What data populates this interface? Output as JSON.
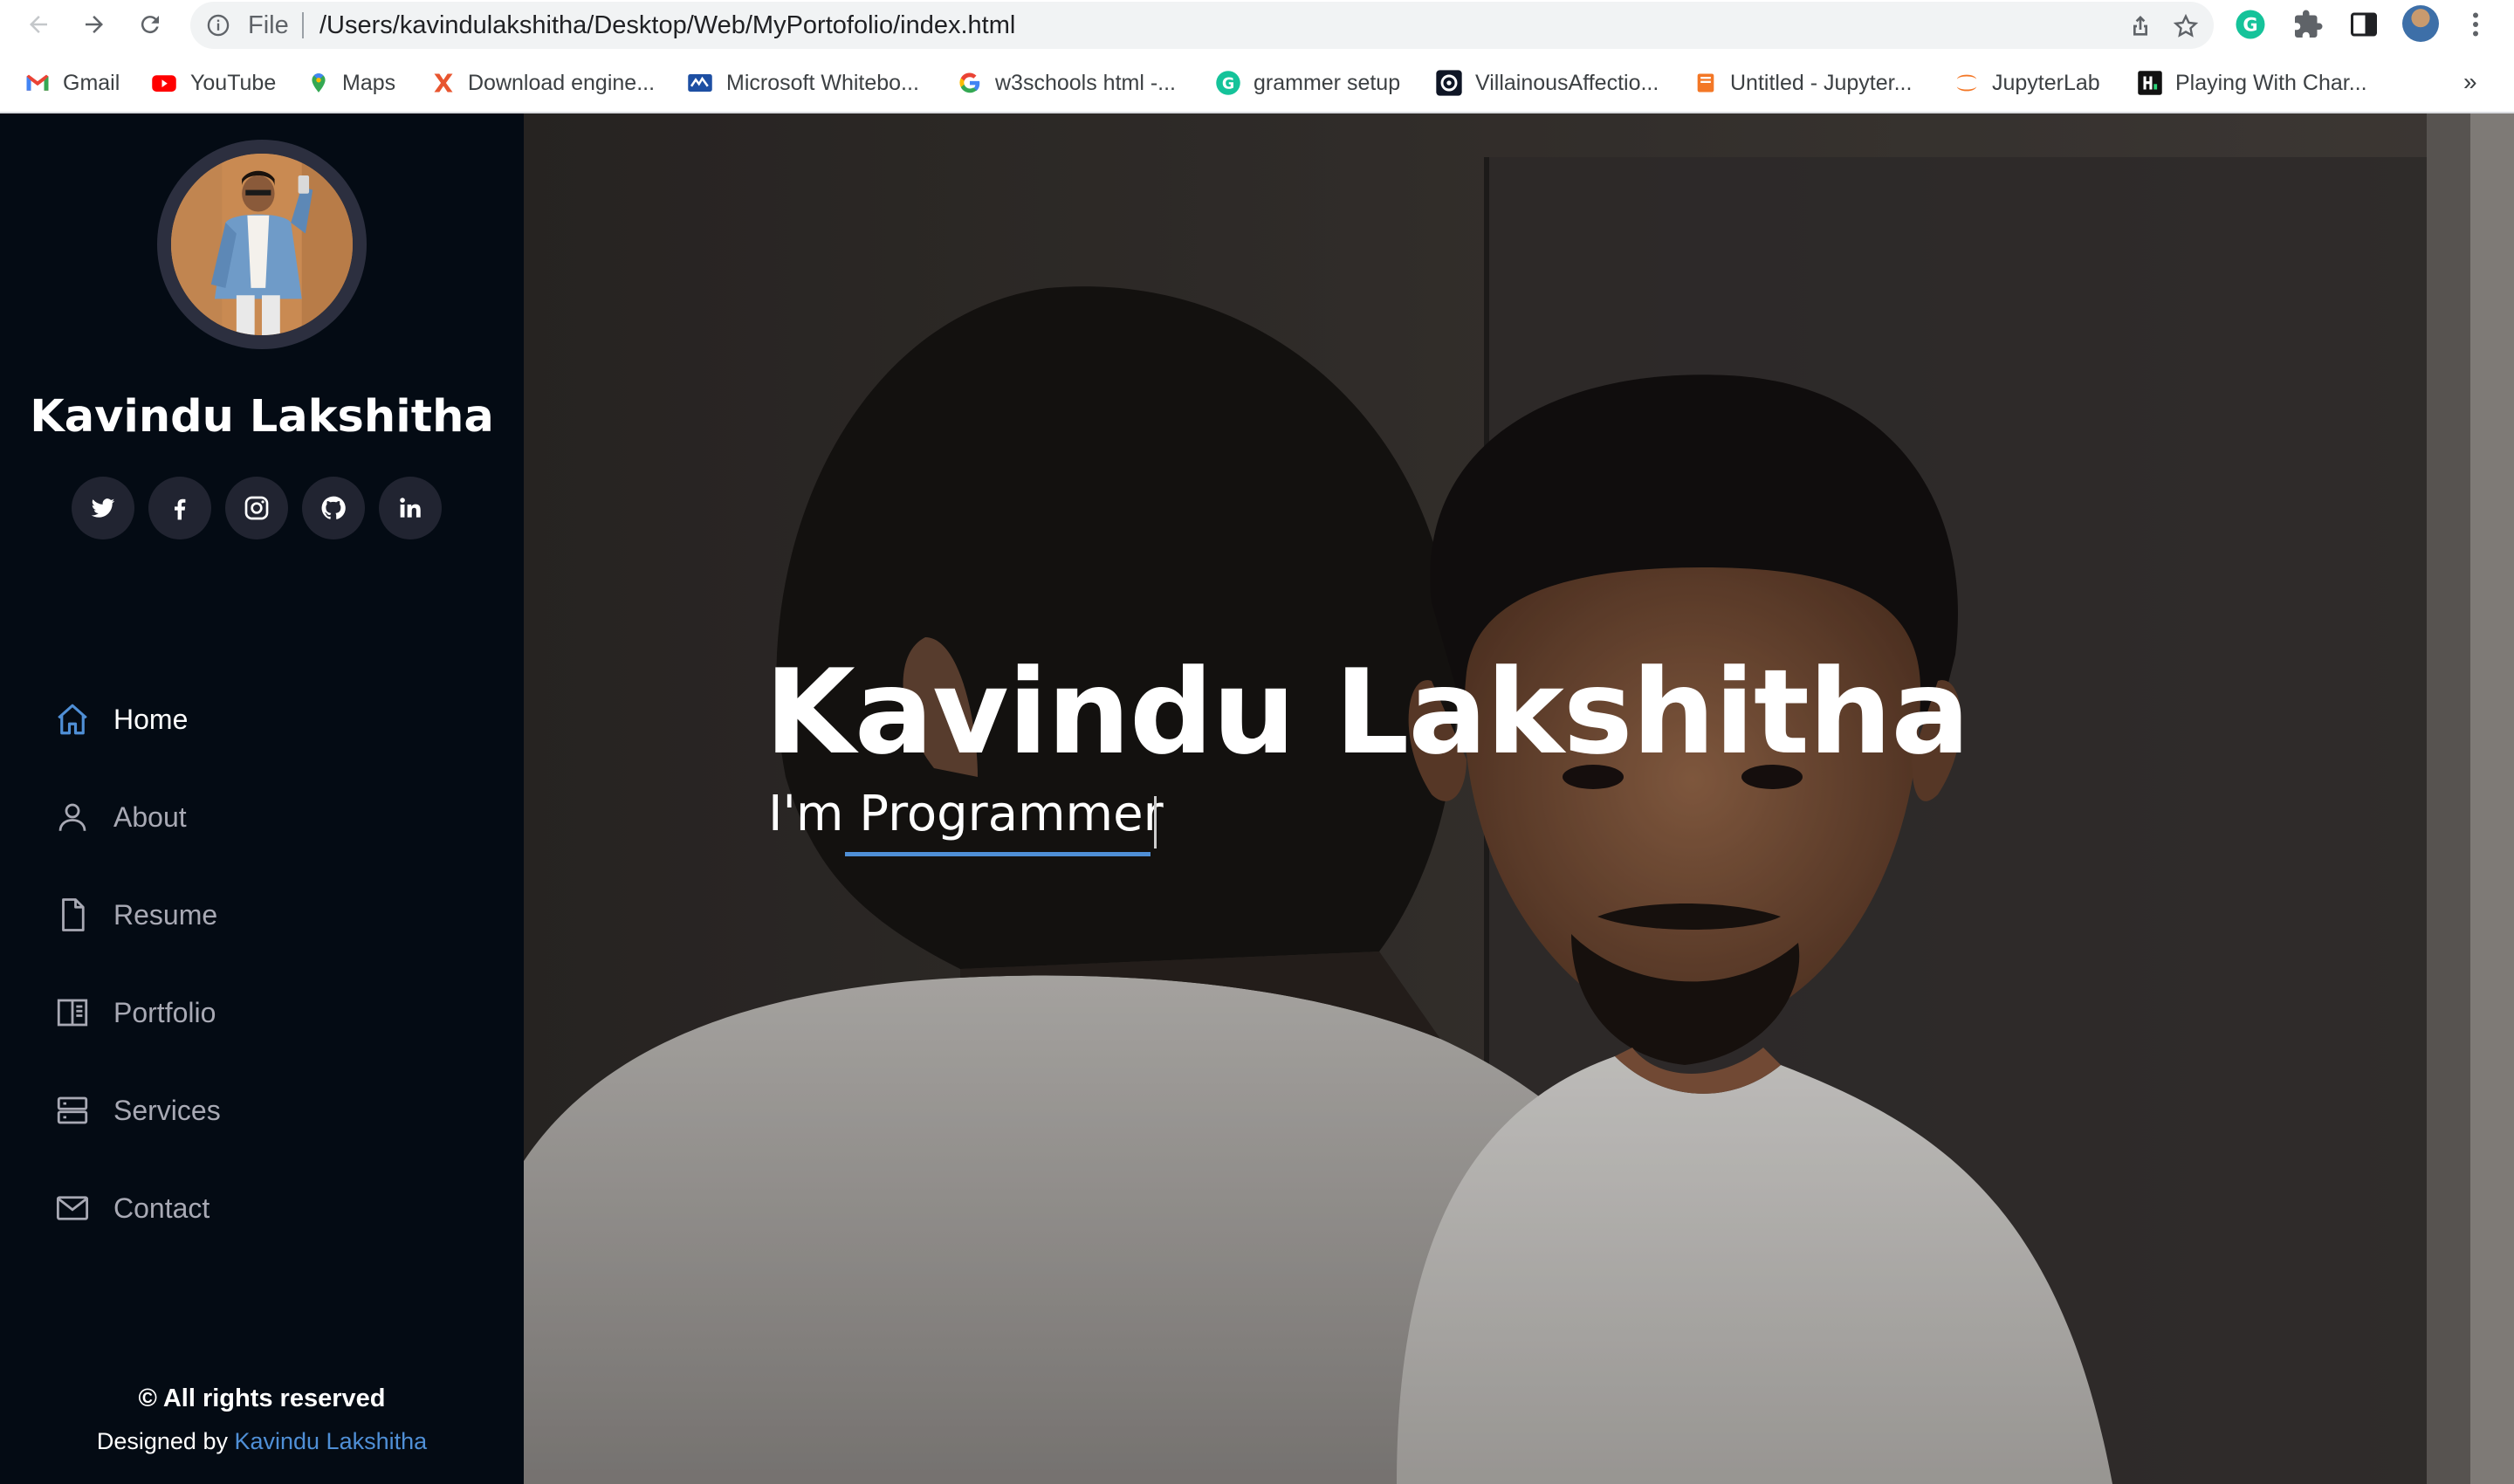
{
  "browser": {
    "scheme": "File",
    "url": "/Users/kavindulakshitha/Desktop/Web/MyPortofolio/index.html",
    "bookmarks": [
      {
        "label": "Gmail",
        "icon": "gmail-icon"
      },
      {
        "label": "YouTube",
        "icon": "youtube-icon"
      },
      {
        "label": "Maps",
        "icon": "maps-icon"
      },
      {
        "label": "Download engine...",
        "icon": "x-icon"
      },
      {
        "label": "Microsoft Whitebo...",
        "icon": "whiteboard-icon"
      },
      {
        "label": "w3schools html -...",
        "icon": "google-icon"
      },
      {
        "label": "grammer setup",
        "icon": "grammarly-icon"
      },
      {
        "label": "VillainousAffectio...",
        "icon": "replit-icon"
      },
      {
        "label": "Untitled - Jupyter...",
        "icon": "notebook-icon"
      },
      {
        "label": "JupyterLab",
        "icon": "jupyter-icon"
      },
      {
        "label": "Playing With Char...",
        "icon": "hashnode-icon"
      }
    ],
    "more_label": "»"
  },
  "sidebar": {
    "name": "Kavindu Lakshitha",
    "social": [
      "twitter-icon",
      "facebook-icon",
      "instagram-icon",
      "github-icon",
      "linkedin-icon"
    ],
    "menu": [
      {
        "label": "Home",
        "icon": "home-icon",
        "active": true
      },
      {
        "label": "About",
        "icon": "user-icon",
        "active": false
      },
      {
        "label": "Resume",
        "icon": "file-icon",
        "active": false
      },
      {
        "label": "Portfolio",
        "icon": "portfolio-icon",
        "active": false
      },
      {
        "label": "Services",
        "icon": "server-icon",
        "active": false
      },
      {
        "label": "Contact",
        "icon": "envelope-icon",
        "active": false
      }
    ],
    "footer": {
      "rights": "© All rights reserved",
      "designed_by_prefix": "Designed by",
      "designer": "Kavindu Lakshitha"
    }
  },
  "hero": {
    "title": "Kavindu Lakshitha",
    "subtitle_prefix": "I'm",
    "typed_text": "Programmer"
  },
  "colors": {
    "sidebar_bg": "#040b14",
    "accent": "#4f8fd6",
    "menu_text": "#a8a9b4"
  }
}
